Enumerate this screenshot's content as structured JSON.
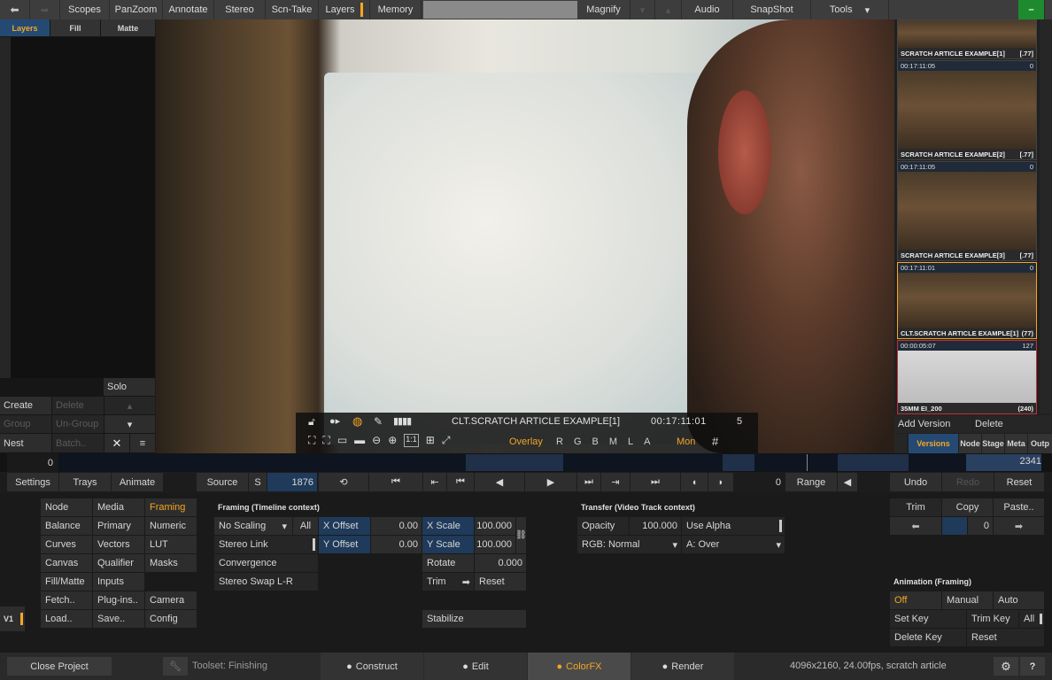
{
  "topbar": {
    "items": [
      "Scopes",
      "PanZoom",
      "Annotate",
      "Stereo",
      "Scn-Take",
      "Layers",
      "Memory",
      "Magnify",
      "Audio",
      "SnapShot",
      "Tools"
    ]
  },
  "layers_panel": {
    "tabs": [
      "Layers",
      "Fill",
      "Matte"
    ],
    "solo": "Solo",
    "create": "Create",
    "delete": "Delete",
    "group": "Group",
    "ungroup": "Un-Group",
    "nest": "Nest",
    "batch": "Batch.."
  },
  "viewer": {
    "clip_name": "CLT.SCRATCH ARTICLE EXAMPLE[1]",
    "timecode": "00:17:11:01",
    "frame": "5",
    "overlay": "Overlay",
    "channels": [
      "R",
      "G",
      "B",
      "M",
      "L",
      "A"
    ],
    "mon": "Mon"
  },
  "tray": {
    "thumbs": [
      {
        "tc": "",
        "cnt": "",
        "name": "SCRATCH ARTICLE EXAMPLE[1]",
        "tag": "[.77]"
      },
      {
        "tc": "00:17:11:05",
        "cnt": "0",
        "name": "SCRATCH ARTICLE EXAMPLE[2]",
        "tag": "[.77]"
      },
      {
        "tc": "00:17:11:05",
        "cnt": "0",
        "name": "SCRATCH ARTICLE EXAMPLE[3]",
        "tag": "[.77]"
      },
      {
        "tc": "00:17:11:01",
        "cnt": "0",
        "name": "CLT.SCRATCH ARTICLE EXAMPLE[1]",
        "tag": "(77)"
      },
      {
        "tc": "00:00:05:07",
        "cnt": "127",
        "name": "35MM EI_200",
        "tag": "(240)"
      }
    ],
    "add_version": "Add Version",
    "delete": "Delete",
    "tabs": [
      "Versions",
      "Node",
      "Stage",
      "Meta",
      "Outp"
    ]
  },
  "timeline": {
    "start": "0",
    "end": "2341"
  },
  "transport": {
    "settings": "Settings",
    "trays": "Trays",
    "animate": "Animate",
    "source": "Source",
    "s": "S",
    "frame": "1876",
    "range_val": "0",
    "range": "Range",
    "undo": "Undo",
    "redo": "Redo",
    "reset": "Reset"
  },
  "menu": {
    "col1": [
      "Node",
      "Balance",
      "Curves",
      "Canvas",
      "Fill/Matte",
      "Fetch..",
      "Load.."
    ],
    "col2": [
      "Media",
      "Primary",
      "Vectors",
      "Qualifier",
      "Inputs",
      "Plug-ins..",
      "Save.."
    ],
    "col3": [
      "Framing",
      "Numeric",
      "LUT",
      "Masks",
      "",
      "Camera",
      "Config"
    ],
    "v1": "V1"
  },
  "framing": {
    "title": "Framing (Timeline context)",
    "scaling": "No Scaling",
    "all": "All",
    "stereo_link": "Stereo Link",
    "convergence": "Convergence",
    "stereo_swap": "Stereo Swap L-R",
    "x_offset_label": "X Offset",
    "x_offset": "0.00",
    "y_offset_label": "Y Offset",
    "y_offset": "0.00",
    "x_scale_label": "X Scale",
    "x_scale": "100.000",
    "y_scale_label": "Y Scale",
    "y_scale": "100.000",
    "rotate_label": "Rotate",
    "rotate": "0.000",
    "trim": "Trim",
    "reset": "Reset",
    "stabilize": "Stabilize"
  },
  "transfer": {
    "title": "Transfer (Video Track context)",
    "opacity_label": "Opacity",
    "opacity": "100.000",
    "use_alpha": "Use Alpha",
    "rgb": "RGB: Normal",
    "a": "A: Over"
  },
  "trimpanel": {
    "trim": "Trim",
    "copy": "Copy",
    "paste": "Paste..",
    "value": "0"
  },
  "animation": {
    "title": "Animation (Framing)",
    "off": "Off",
    "manual": "Manual",
    "auto": "Auto",
    "set_key": "Set Key",
    "trim_key": "Trim Key",
    "all": "All",
    "delete_key": "Delete Key",
    "reset": "Reset"
  },
  "statusbar": {
    "close_project": "Close Project",
    "toolset": "Toolset: Finishing",
    "tabs": [
      "Construct",
      "Edit",
      "ColorFX",
      "Render"
    ],
    "active_tab": "ColorFX",
    "info": "4096x2160, 24.00fps, scratch article"
  },
  "colors": {
    "accent": "#f5a623",
    "blue": "#1f3a5a"
  }
}
